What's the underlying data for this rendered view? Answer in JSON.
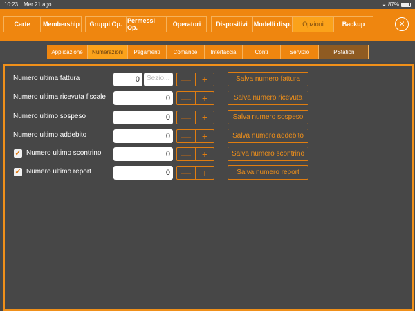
{
  "status": {
    "time": "10:23",
    "date": "Mer 21 ago",
    "battery": "87%",
    "battery_level": 0.87
  },
  "colors": {
    "accent": "#ef860f",
    "selected": "#fba21a",
    "ipstation": "#8f5b22",
    "background": "#474747"
  },
  "top_tabs": [
    {
      "label": "Carte"
    },
    {
      "label": "Membership"
    },
    {
      "label": "Gruppi Op."
    },
    {
      "label": "Permessi Op."
    },
    {
      "label": "Operatori"
    },
    {
      "label": "Dispositivi"
    },
    {
      "label": "Modelli disp."
    },
    {
      "label": "Opzioni",
      "selected": true
    },
    {
      "label": "Backup"
    }
  ],
  "close_icon": "×",
  "sub_tabs": [
    {
      "label": "Applicazione"
    },
    {
      "label": "Numerazioni",
      "selected": true
    },
    {
      "label": "Pagamenti"
    },
    {
      "label": "Comande"
    },
    {
      "label": "Interfaccia"
    },
    {
      "label": "Conti"
    },
    {
      "label": "Servizio"
    },
    {
      "label": "iPStation"
    }
  ],
  "rows": [
    {
      "label": "Numero ultima fattura",
      "value": "0",
      "section_placeholder": "Sezio...",
      "save": "Salva numero fattura"
    },
    {
      "label": "Numero ultima ricevuta fiscale",
      "value": "0",
      "save": "Salva numero ricevuta"
    },
    {
      "label": "Numero ultimo sospeso",
      "value": "0",
      "save": "Salva numero sospeso"
    },
    {
      "label": "Numero ultimo addebito",
      "value": "0",
      "save": "Salva numero addebito"
    },
    {
      "label": "Numero ultimo scontrino",
      "value": "0",
      "checked": true,
      "save": "Salva numero scontrino"
    },
    {
      "label": "Numero ultimo report",
      "value": "0",
      "checked": true,
      "save": "Salva numero report"
    }
  ],
  "stepper": {
    "minus": "—",
    "plus": "+"
  }
}
